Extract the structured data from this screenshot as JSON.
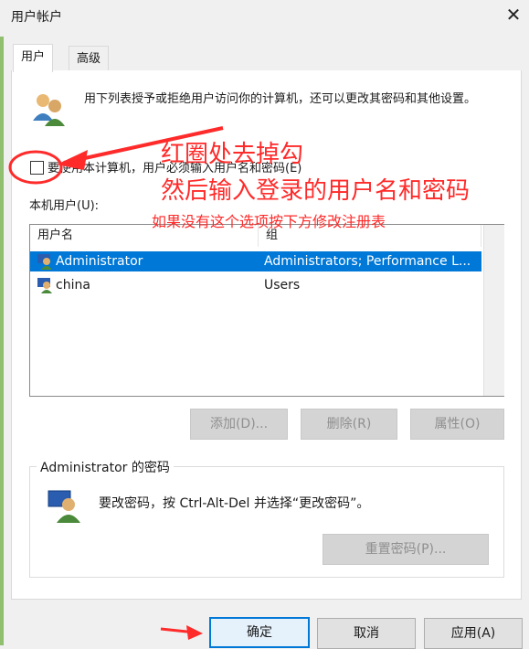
{
  "window": {
    "title": "用户帐户",
    "close_glyph": "✕"
  },
  "tabs": [
    {
      "label": "用户"
    },
    {
      "label": "高级"
    }
  ],
  "users_tab": {
    "description": "用下列表授予或拒绝用户访问你的计算机，还可以更改其密码和其他设置。",
    "require_login_checkbox": {
      "label": "要使用本计算机，用户必须输入用户名和密码(E)",
      "checked": false
    },
    "local_users_label": "本机用户(U):",
    "columns": [
      "用户名",
      "组"
    ],
    "users": [
      {
        "name": "Administrator",
        "group": "Administrators; Performance L...",
        "selected": true
      },
      {
        "name": "china",
        "group": "Users",
        "selected": false
      }
    ],
    "buttons": {
      "add": "添加(D)...",
      "remove": "删除(R)",
      "properties": "属性(O)"
    },
    "password_group": {
      "title": "Administrator 的密码",
      "text": "要改密码，按 Ctrl-Alt-Del 并选择“更改密码”。",
      "reset_button": "重置密码(P)..."
    }
  },
  "dialog_buttons": {
    "ok": "确定",
    "cancel": "取消",
    "apply": "应用(A)"
  },
  "annotations": {
    "line1": "红圈处去掉勾",
    "line2": "然后输入登录的用户名和密码",
    "line3": "如果没有这个选项按下方修改注册表",
    "color": "#ff2a2a"
  },
  "colors": {
    "selection": "#0078d7",
    "primary_border": "#0078d7"
  }
}
